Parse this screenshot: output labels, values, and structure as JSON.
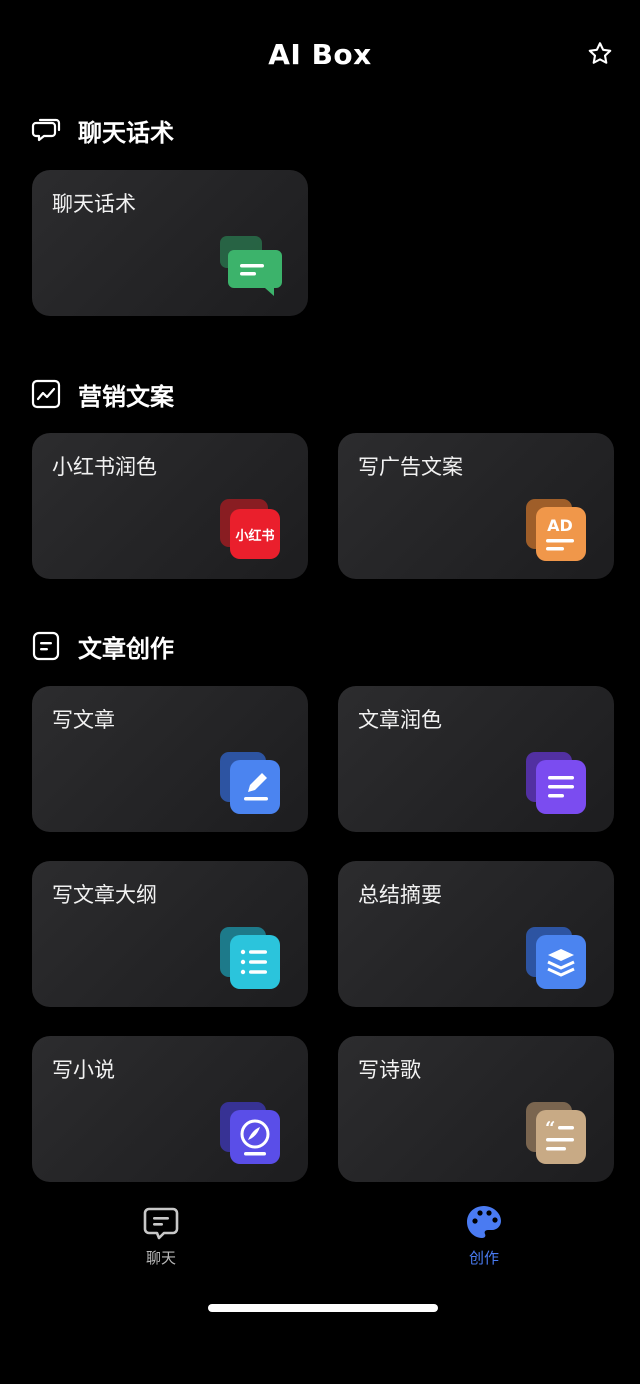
{
  "header": {
    "title": "AI Box"
  },
  "sections": [
    {
      "title": "聊天话术",
      "cards": [
        {
          "label": "聊天话术"
        }
      ]
    },
    {
      "title": "营销文案",
      "cards": [
        {
          "label": "小红书润色",
          "badge": "小红书"
        },
        {
          "label": "写广告文案",
          "badge": "AD"
        }
      ]
    },
    {
      "title": "文章创作",
      "cards": [
        {
          "label": "写文章"
        },
        {
          "label": "文章润色"
        },
        {
          "label": "写文章大纲"
        },
        {
          "label": "总结摘要"
        },
        {
          "label": "写小说"
        },
        {
          "label": "写诗歌"
        }
      ]
    }
  ],
  "tabbar": {
    "tabs": [
      {
        "label": "聊天",
        "active": false
      },
      {
        "label": "创作",
        "active": true
      }
    ],
    "active_color": "#4a7bf2",
    "inactive_color": "#b9b9b9"
  }
}
